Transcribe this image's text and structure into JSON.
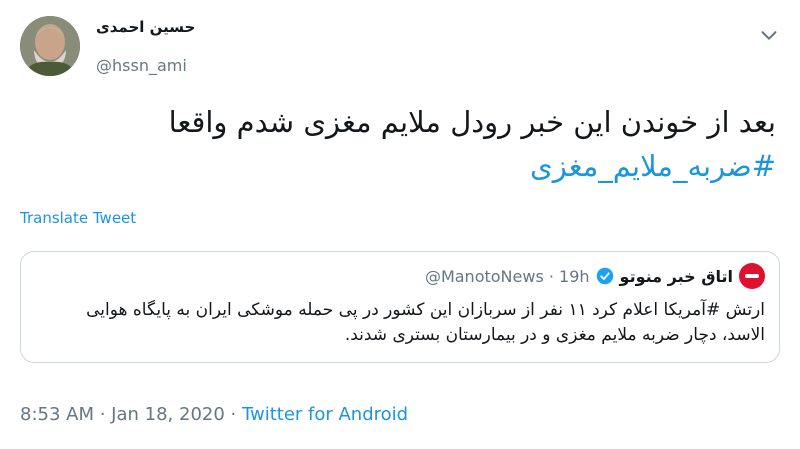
{
  "author": {
    "display_name": "حسین احمدی",
    "handle": "@hssn_ami"
  },
  "tweet": {
    "text": "بعد از خوندن این خبر رودل ملایم مغزی شدم واقعا",
    "hashtag": "#ضربه_ملایم_مغزی"
  },
  "translate_label": "Translate Tweet",
  "quoted": {
    "name": "اتاق خبر منوتو",
    "handle_time": "@ManotoNews · 19h",
    "text": "ارتش #آمریکا اعلام کرد ۱۱ نفر از سربازان این کشور در پی حمله موشکی ایران به پایگاه هوایی الاسد، دچار ضربه ملایم مغزی و در بیمارستان بستری شدند."
  },
  "meta": {
    "time": "8:53 AM",
    "sep1": " · ",
    "date": "Jan 18, 2020",
    "sep2": " · ",
    "source": "Twitter for Android"
  },
  "colors": {
    "link": "#1b95e0",
    "muted": "#657786",
    "border": "#ccd6dd",
    "manoto_red": "#e0102e"
  },
  "icons": [
    "chevron-down-icon",
    "verified-badge-icon"
  ]
}
